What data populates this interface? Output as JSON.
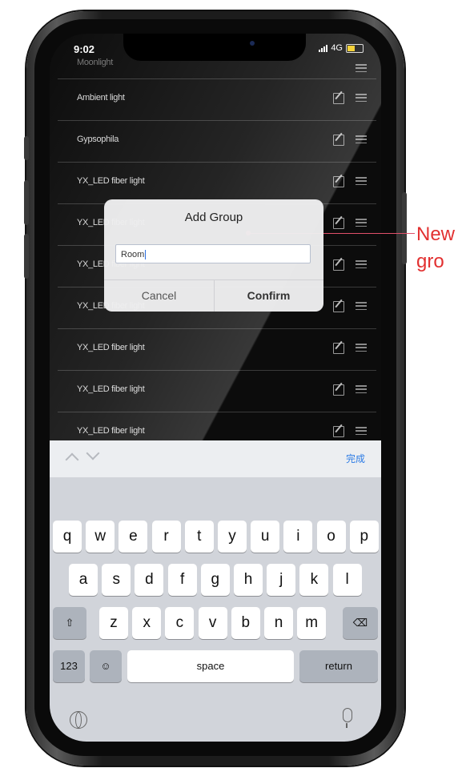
{
  "status_bar": {
    "time": "9:02",
    "network": "4G"
  },
  "list": {
    "partial_top": "Moonlight",
    "items": [
      {
        "label": "Ambient light"
      },
      {
        "label": "Gypsophila"
      },
      {
        "label": "YX_LED fiber light"
      },
      {
        "label": "YX_LED fiber light"
      },
      {
        "label": "YX_LED fiber light"
      },
      {
        "label": "YX_LED fiber light"
      },
      {
        "label": "YX_LED fiber light"
      },
      {
        "label": "YX_LED fiber light"
      },
      {
        "label": "YX_LED fiber light"
      }
    ]
  },
  "dialog": {
    "title": "Add Group",
    "input_value": "Room",
    "cancel_label": "Cancel",
    "confirm_label": "Confirm"
  },
  "keyboard": {
    "done_label": "完成",
    "row1": [
      "q",
      "w",
      "e",
      "r",
      "t",
      "y",
      "u",
      "i",
      "o",
      "p"
    ],
    "row2": [
      "a",
      "s",
      "d",
      "f",
      "g",
      "h",
      "j",
      "k",
      "l"
    ],
    "row3": [
      "z",
      "x",
      "c",
      "v",
      "b",
      "n",
      "m"
    ],
    "numbers_label": "123",
    "space_label": "space",
    "return_label": "return"
  },
  "annotation": {
    "text": "New\ngro"
  },
  "colors": {
    "annotation": "#e23030",
    "keyboard_done": "#2c7be5"
  }
}
